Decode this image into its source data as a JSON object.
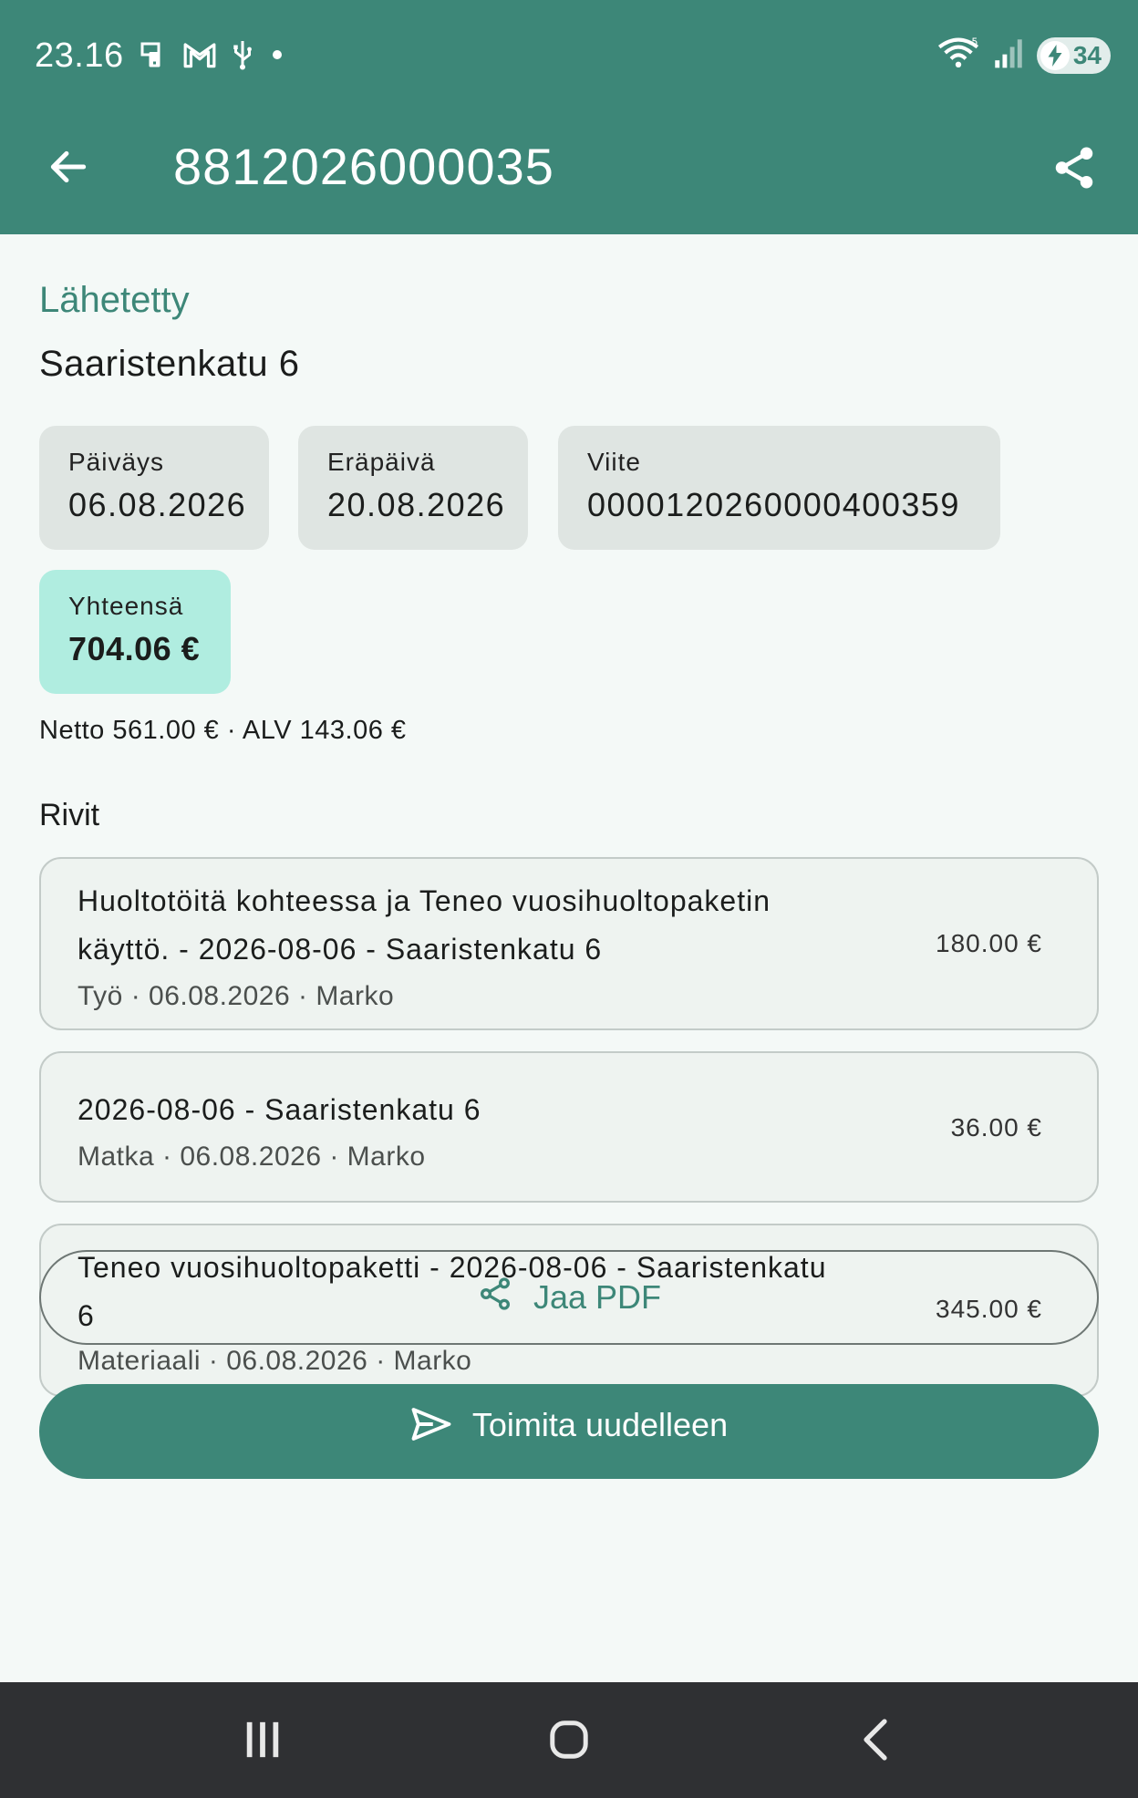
{
  "status_bar": {
    "time": "23.16",
    "battery": "34",
    "icons_left": [
      "phone-notification-icon",
      "gmail-icon",
      "usb-icon",
      "dot-icon"
    ],
    "icons_right": [
      "wifi-icon",
      "signal-icon",
      "battery-charging-icon"
    ]
  },
  "app_bar": {
    "title": "8812026000035",
    "back_icon": "arrow-back-icon",
    "share_icon": "share-icon"
  },
  "invoice": {
    "status": "Lähetetty",
    "address": "Saaristenkatu 6",
    "date_label": "Päiväys",
    "date_value": "06.08.2026",
    "due_label": "Eräpäivä",
    "due_value": "20.08.2026",
    "ref_label": "Viite",
    "ref_value": "00001202600004003‌59",
    "total_label": "Yhteensä",
    "total_value": "704.06 €",
    "net_line": "Netto 561.00 € · ALV 143.06 €",
    "rows_heading": "Rivit"
  },
  "rows": [
    {
      "desc_line1": "Huoltotöitä kohteessa ja Teneo vuosihuoltopaketin",
      "desc_line2": "käyttö. - 2026-08-06 - Saaristenkatu 6",
      "meta": "Työ · 06.08.2026 · Marko",
      "amount": "180.00 €"
    },
    {
      "desc_line1": "2026-08-06 - Saaristenkatu 6",
      "meta": "Matka · 06.08.2026 · Marko",
      "amount": "36.00 €"
    },
    {
      "desc_line1": "Teneo vuosihuoltopaketti - 2026-08-06 - Saaristenkatu",
      "desc_line2": "6",
      "meta": "Materiaali · 06.08.2026 · Marko",
      "amount": "345.00 €"
    }
  ],
  "actions": {
    "share_pdf": "Jaa PDF",
    "resend": "Toimita uudelleen"
  },
  "colors": {
    "primary": "#3d8778",
    "background": "#f4f9f7",
    "chip": "#dfe5e2",
    "total_chip": "#b0ede0",
    "navbar": "#2f3033"
  }
}
